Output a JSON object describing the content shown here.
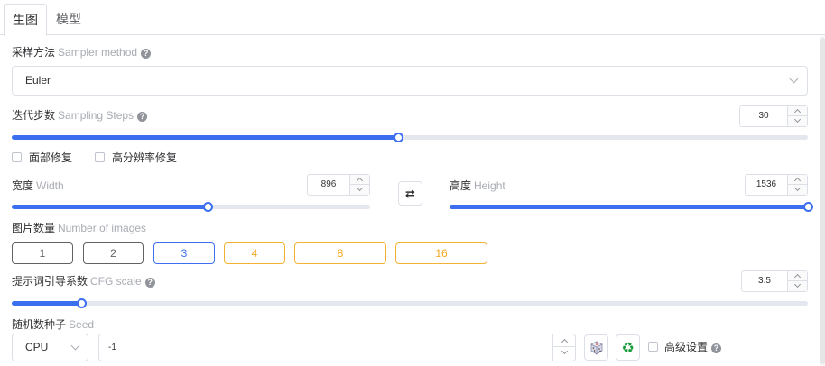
{
  "tabs": [
    {
      "label": "生图",
      "active": true
    },
    {
      "label": "模型",
      "active": false
    }
  ],
  "sampler": {
    "label": "采样方法",
    "label_en": "Sampler method",
    "value": "Euler"
  },
  "steps": {
    "label": "迭代步数",
    "label_en": "Sampling Steps",
    "value": "30",
    "fill_fraction": 0.4855
  },
  "checkboxes": {
    "face_restore": "面部修复",
    "hires_fix": "高分辨率修复"
  },
  "width": {
    "label": "宽度",
    "label_en": "Width",
    "value": "896",
    "fill_fraction": 0.5455
  },
  "height": {
    "label": "高度",
    "label_en": "Height",
    "value": "1536",
    "fill_fraction": 1.0
  },
  "swap_icon": "swap-arrows",
  "images": {
    "label": "图片数量",
    "label_en": "Number of images",
    "options": [
      "1",
      "2",
      "3",
      "4",
      "8",
      "16"
    ],
    "selected": "3"
  },
  "cfg": {
    "label": "提示词引导系数",
    "label_en": "CFG scale",
    "value": "3.5",
    "fill_fraction": 0.0877
  },
  "seed": {
    "label": "随机数种子",
    "label_en": "Seed",
    "device": "CPU",
    "value": "-1"
  },
  "advanced": {
    "label": "高级设置"
  },
  "help_glyph": "?",
  "colors": {
    "accent": "#3b6ff0",
    "warning": "#f3b234",
    "recycle": "#1a9b3c"
  }
}
